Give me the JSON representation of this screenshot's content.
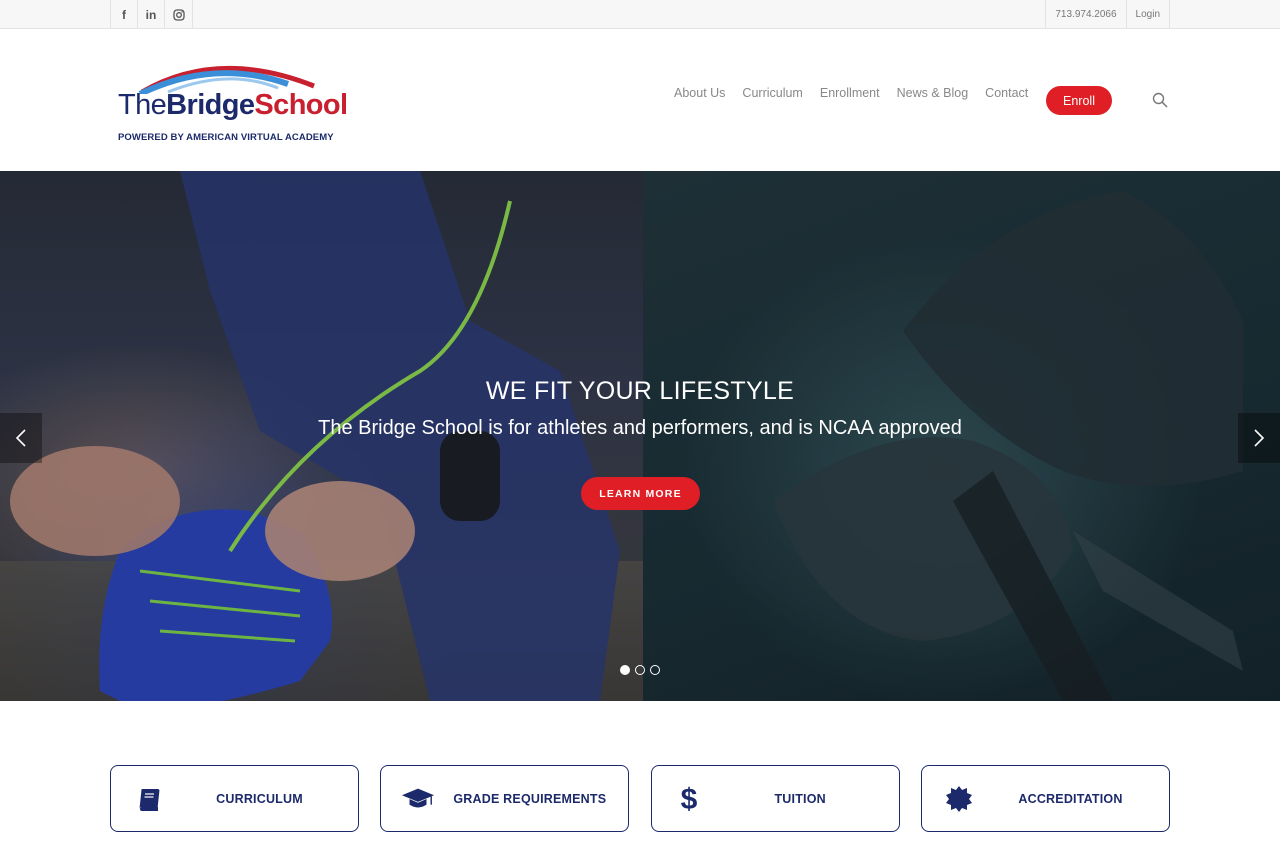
{
  "topbar": {
    "social": [
      {
        "icon": "facebook-icon",
        "glyph": "f"
      },
      {
        "icon": "linkedin-icon",
        "glyph": "in"
      },
      {
        "icon": "instagram-icon",
        "glyph": ""
      }
    ],
    "phone": "713.974.2066",
    "login": "Login"
  },
  "header": {
    "logo": {
      "the": "The",
      "bridge": "Bridge",
      "school": "School",
      "tagline": "POWERED BY AMERICAN VIRTUAL ACADEMY"
    },
    "nav": [
      "About Us",
      "Curriculum",
      "Enrollment",
      "News & Blog",
      "Contact"
    ],
    "enroll": "Enroll",
    "search_icon": "search-icon"
  },
  "hero": {
    "title": "WE FIT YOUR LIFESTYLE",
    "subtitle": "The Bridge School is for athletes and performers, and is NCAA approved",
    "button": "LEARN MORE",
    "slides": 3,
    "active_slide": 1
  },
  "features": [
    {
      "label": "CURRICULUM",
      "icon": "book-icon"
    },
    {
      "label": "GRADE REQUIREMENTS",
      "icon": "graduation-cap-icon"
    },
    {
      "label": "TUITION",
      "icon": "dollar-icon"
    },
    {
      "label": "ACCREDITATION",
      "icon": "seal-icon"
    }
  ],
  "colors": {
    "brand_navy": "#1c2a6b",
    "brand_red": "#e01e25",
    "logo_blue": "#3a8fd8"
  }
}
